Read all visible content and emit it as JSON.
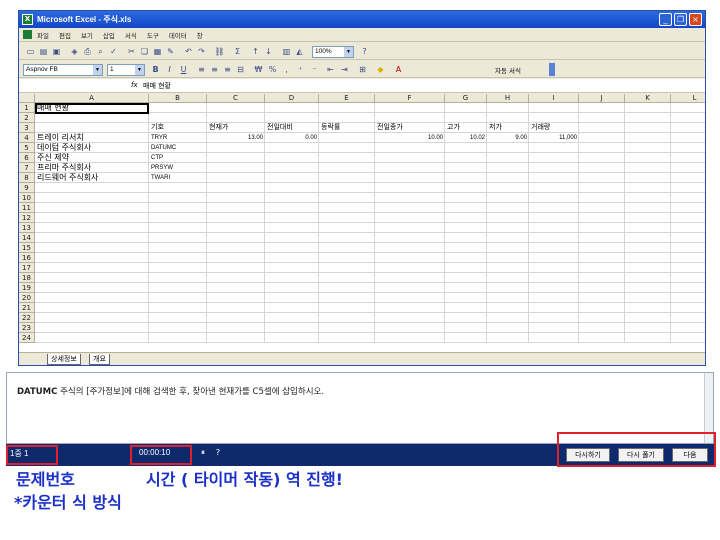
{
  "window": {
    "title": "Microsoft Excel - 주식.xls",
    "app_icon": "X",
    "minimize": "_",
    "restore": "❐",
    "close": "×"
  },
  "menu": [
    "파일",
    "편집",
    "보기",
    "삽입",
    "서식",
    "도구",
    "데이터",
    "창"
  ],
  "toolbar": {
    "zoom": "100%",
    "font": "Aspnov FB",
    "size": "1",
    "bold": "B",
    "italic": "I",
    "underline": "U",
    "percent": "%",
    "auto_format": "자동 서식"
  },
  "formula_bar": {
    "fx": "fx",
    "value": "매매 현황"
  },
  "columns": [
    "A",
    "B",
    "C",
    "D",
    "E",
    "F",
    "G",
    "H",
    "I",
    "J",
    "K",
    "L"
  ],
  "rows": [
    "1",
    "2",
    "3",
    "4",
    "5",
    "6",
    "7",
    "8",
    "9",
    "10",
    "11",
    "12",
    "13",
    "14",
    "15",
    "16",
    "17",
    "18",
    "19",
    "20",
    "21",
    "22",
    "23",
    "24"
  ],
  "cells": {
    "A1": "매매 현황",
    "B3": "기호",
    "C3": "현재가",
    "D3": "전일대비",
    "E3": "등락률",
    "F3": "전일종가",
    "G3": "고가",
    "H3": "저가",
    "I3": "거래량",
    "A4": "트레이 리서치",
    "B4": "TRYR",
    "C4": "13.00",
    "D4": "0.00",
    "F4": "10.00",
    "G4": "10.02",
    "H4": "9.00",
    "I4": "11,000",
    "A5": "데이텀 주식회사",
    "B5": "DATUMC",
    "A6": "주신 제약",
    "B6": "CTP",
    "A7": "프리마 주식회사",
    "B7": "PRSYW",
    "A8": "리드웨어 주식회사",
    "B8": "TWARI"
  },
  "sheet_tabs": [
    "상세정보",
    "개요"
  ],
  "question": {
    "code": "DATUMC",
    "text": " 주식의 [주가정보]에 대해 검색한 후, 찾아낸 현재가를 C5셀에 삽입하시오."
  },
  "status": {
    "counter": "1중 1",
    "timer": "00:00:10"
  },
  "buttons": {
    "reset": "다시하기",
    "retry": "다시 풀기",
    "next": "다음"
  },
  "captions": {
    "problem_number": "문제번호",
    "timer_note": "시간 ( 타이머 작동) 역 진행!",
    "counter_note": "*카운터 식 방식"
  },
  "colors": {
    "title_bar": "#1346c6",
    "status_bar": "#0f2a6c",
    "highlight_box": "#e0202a",
    "caption_text": "#1a30c8"
  }
}
